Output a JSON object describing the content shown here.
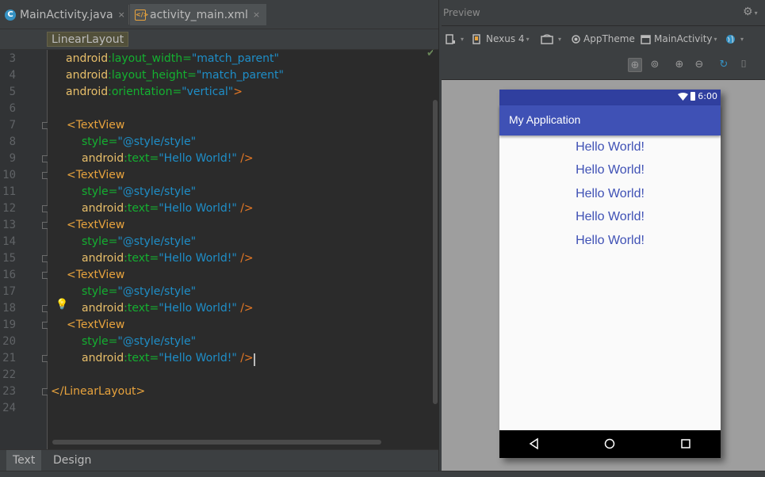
{
  "editor": {
    "tabs": [
      {
        "label": "MainActivity.java",
        "icon": "java-class-icon",
        "close": "×"
      },
      {
        "label": "activity_main.xml",
        "icon": "xml-file-icon",
        "close": "×"
      }
    ],
    "breadcrumb": "LinearLayout",
    "line_numbers": [
      "3",
      "4",
      "5",
      "6",
      "7",
      "8",
      "9",
      "10",
      "11",
      "12",
      "13",
      "14",
      "15",
      "16",
      "17",
      "18",
      "19",
      "20",
      "21",
      "22",
      "23",
      "24"
    ],
    "code_lines": [
      [
        {
          "t": "android",
          "c": "attr-ns"
        },
        {
          "t": ":layout_width=",
          "c": "attr-name"
        },
        {
          "t": "\"match_parent\"",
          "c": "val"
        }
      ],
      [
        {
          "t": "android",
          "c": "attr-ns"
        },
        {
          "t": ":layout_height=",
          "c": "attr-name"
        },
        {
          "t": "\"match_parent\"",
          "c": "val"
        }
      ],
      [
        {
          "t": "android",
          "c": "attr-ns"
        },
        {
          "t": ":orientation=",
          "c": "attr-name"
        },
        {
          "t": "\"vertical\"",
          "c": "val"
        },
        {
          "t": ">",
          "c": "punct"
        }
      ],
      [],
      [
        {
          "t": "<TextView",
          "c": "ttag"
        }
      ],
      [
        {
          "t": "style=",
          "c": "attr-name"
        },
        {
          "t": "\"@style/style\"",
          "c": "val"
        }
      ],
      [
        {
          "t": "android",
          "c": "attr-ns"
        },
        {
          "t": ":text=",
          "c": "attr-name"
        },
        {
          "t": "\"Hello World!\"",
          "c": "val"
        },
        {
          "t": " />",
          "c": "punct"
        }
      ],
      [
        {
          "t": "<TextView",
          "c": "ttag"
        }
      ],
      [
        {
          "t": "style=",
          "c": "attr-name"
        },
        {
          "t": "\"@style/style\"",
          "c": "val"
        }
      ],
      [
        {
          "t": "android",
          "c": "attr-ns"
        },
        {
          "t": ":text=",
          "c": "attr-name"
        },
        {
          "t": "\"Hello World!\"",
          "c": "val"
        },
        {
          "t": " />",
          "c": "punct"
        }
      ],
      [
        {
          "t": "<TextView",
          "c": "ttag"
        }
      ],
      [
        {
          "t": "style=",
          "c": "attr-name"
        },
        {
          "t": "\"@style/style\"",
          "c": "val"
        }
      ],
      [
        {
          "t": "android",
          "c": "attr-ns"
        },
        {
          "t": ":text=",
          "c": "attr-name"
        },
        {
          "t": "\"Hello World!\"",
          "c": "val"
        },
        {
          "t": " />",
          "c": "punct"
        }
      ],
      [
        {
          "t": "<TextView",
          "c": "ttag"
        }
      ],
      [
        {
          "t": "style=",
          "c": "attr-name"
        },
        {
          "t": "\"@style/style\"",
          "c": "val"
        }
      ],
      [
        {
          "t": "android",
          "c": "attr-ns"
        },
        {
          "t": ":text=",
          "c": "attr-name"
        },
        {
          "t": "\"Hello World!\"",
          "c": "val"
        },
        {
          "t": " />",
          "c": "punct"
        }
      ],
      [
        {
          "t": "<TextView",
          "c": "ttag"
        }
      ],
      [
        {
          "t": "style=",
          "c": "attr-name"
        },
        {
          "t": "\"@style/style\"",
          "c": "val"
        }
      ],
      [
        {
          "t": "android",
          "c": "attr-ns"
        },
        {
          "t": ":text=",
          "c": "attr-name"
        },
        {
          "t": "\"Hello World!\"",
          "c": "val"
        },
        {
          "t": " />",
          "c": "punct"
        }
      ],
      [],
      [
        {
          "t": "</LinearLayout>",
          "c": "ttag"
        }
      ],
      []
    ],
    "bottom_tabs": [
      {
        "label": "Text",
        "active": true
      },
      {
        "label": "Design",
        "active": false
      }
    ]
  },
  "preview": {
    "title": "Preview",
    "toolbar": {
      "device": "Nexus 4",
      "theme": "AppTheme",
      "activity": "MainActivity"
    },
    "phone": {
      "time": "6:00",
      "app_title": "My Application",
      "texts": [
        "Hello World!",
        "Hello World!",
        "Hello World!",
        "Hello World!",
        "Hello World!"
      ]
    }
  },
  "colors": {
    "primary": "#3f51b5",
    "primary_dark": "#303f9f",
    "editor_bg": "#2b2b2b"
  }
}
